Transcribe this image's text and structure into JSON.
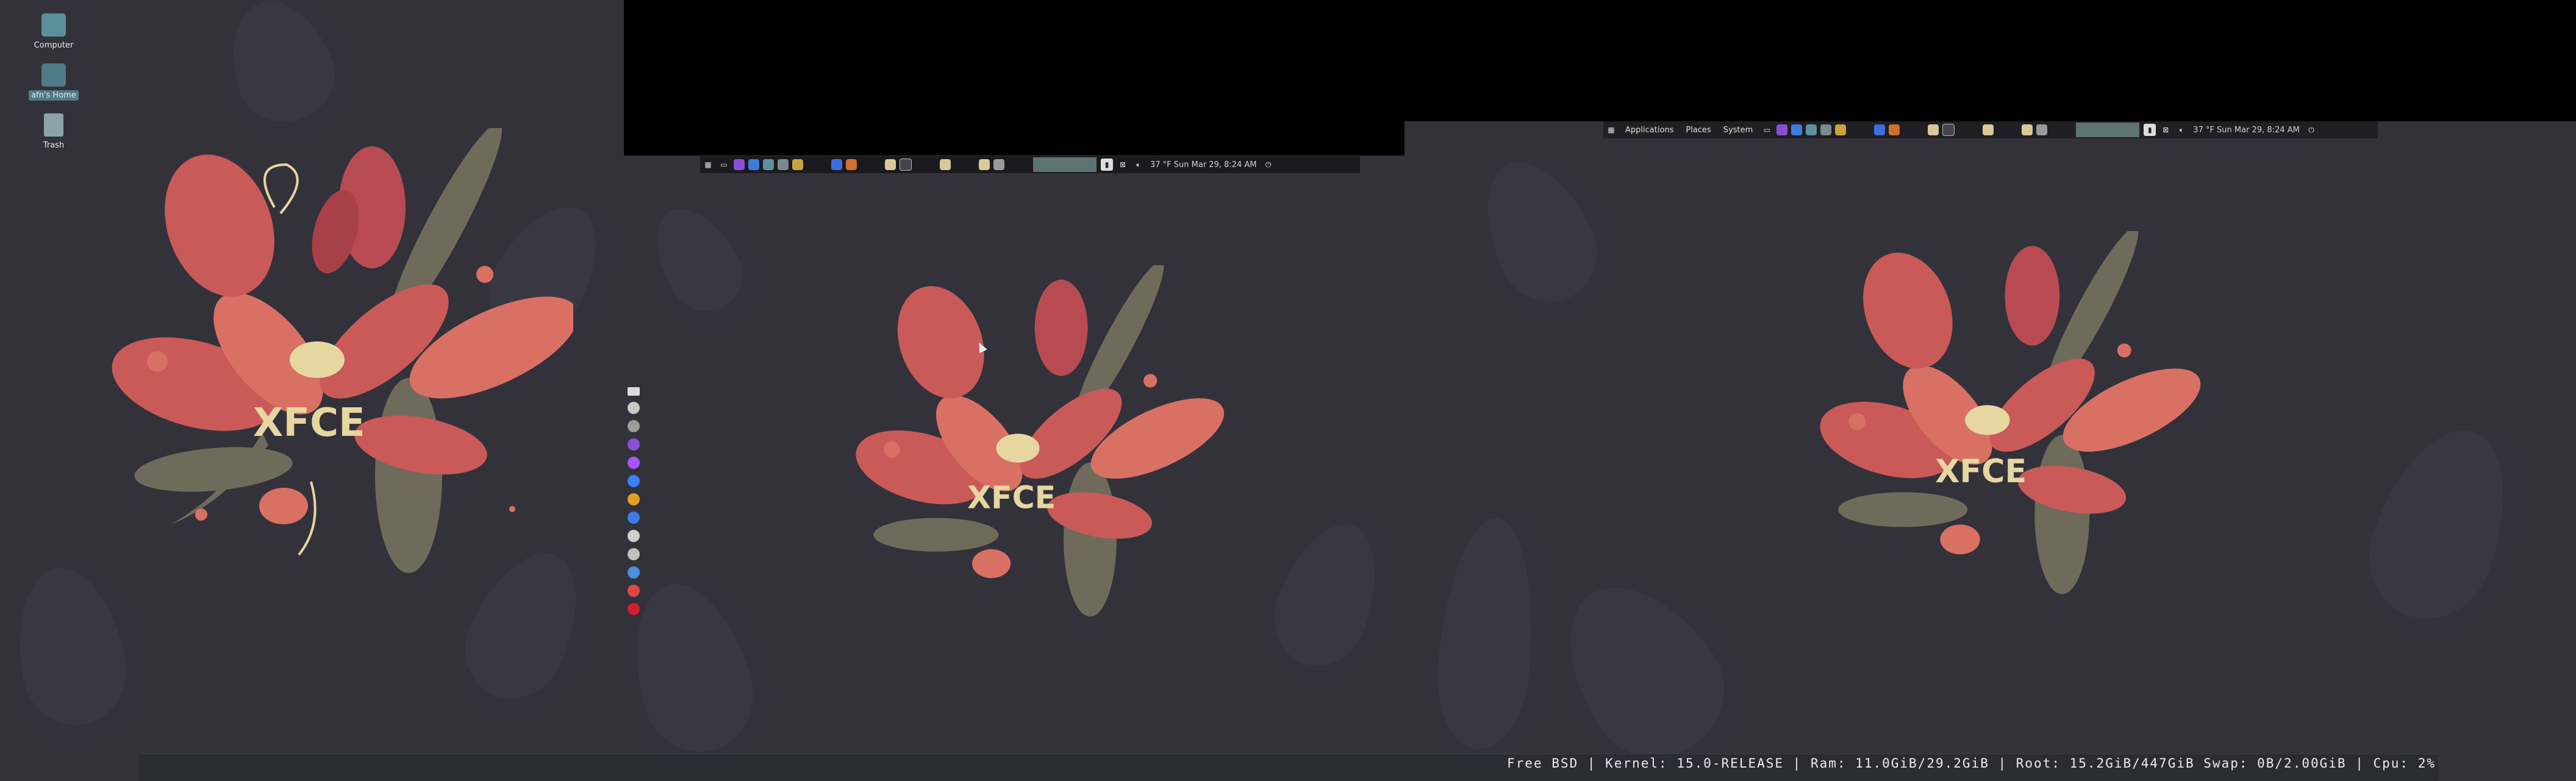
{
  "desktop": {
    "icons": [
      {
        "label": "Computer",
        "icon": "computer-icon"
      },
      {
        "label": "afn's Home",
        "icon": "home-folder-icon"
      },
      {
        "label": "Trash",
        "icon": "trash-icon"
      }
    ],
    "wallpaper_logo": "XFCE"
  },
  "panel_mid": {
    "clock": "37 °F  Sun Mar 29,  8:24 AM"
  },
  "panel_right": {
    "menu": {
      "applications": "Applications",
      "places": "Places",
      "system": "System"
    },
    "clock": "37 °F  Sun Mar 29,  8:24 AM"
  },
  "status_bar": {
    "text": "Free BSD | Kernel: 15.0-RELEASE | Ram: 11.0GiB/29.2GiB | Root: 15.2GiB/447GiB  Swap: 0B/2.00GiB  | Cpu: 2%"
  },
  "colors": {
    "background": "#33323b",
    "leaf_red": "#c95a58",
    "leaf_pink": "#d97064",
    "olive": "#6e6b5b",
    "cream": "#e6d6a0",
    "teal_selection": "#4f7b87",
    "panel": "#1a1a1f",
    "pager_active": "#5e7273"
  }
}
